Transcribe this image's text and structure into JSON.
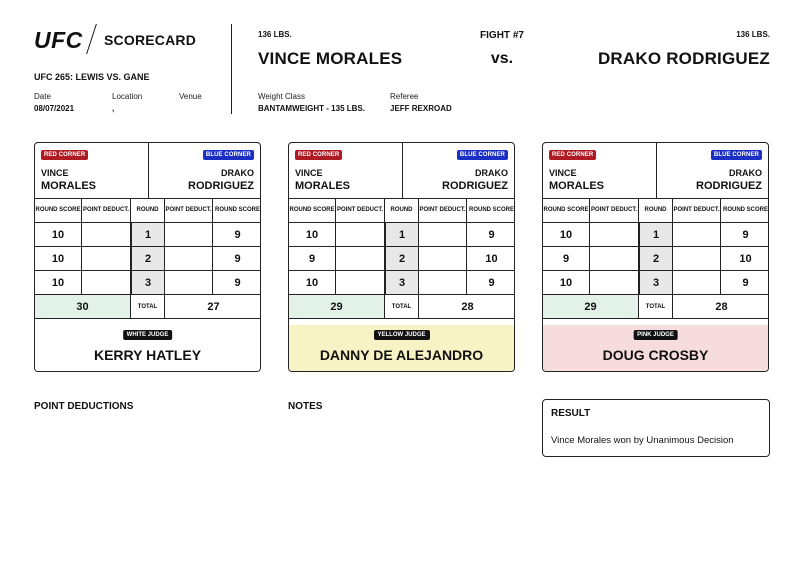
{
  "header": {
    "logo_text": "UFC",
    "title": "SCORECARD",
    "event": "UFC 265: LEWIS VS. GANE",
    "date_label": "Date",
    "date_value": "08/07/2021",
    "location_label": "Location",
    "location_value": ",",
    "venue_label": "Venue",
    "venue_value": "",
    "red_weight": "136 LBS.",
    "red_fighter": "VINCE MORALES",
    "blue_weight": "136 LBS.",
    "blue_fighter": "DRAKO RODRIGUEZ",
    "fight_number": "FIGHT #7",
    "vs": "vs.",
    "weight_class_label": "Weight Class",
    "weight_class_value": "BANTAMWEIGHT - 135 LBS.",
    "referee_label": "Referee",
    "referee_value": "JEFF REXROAD"
  },
  "labels": {
    "red_corner": "RED CORNER",
    "blue_corner": "BLUE CORNER",
    "round_score": "ROUND SCORE",
    "point_deduct": "POINT DEDUCT.",
    "round": "ROUND",
    "total": "TOTAL"
  },
  "cards": [
    {
      "red_first": "VINCE",
      "red_last": "MORALES",
      "blue_first": "DRAKO",
      "blue_last": "RODRIGUEZ",
      "rounds": [
        {
          "red_score": "10",
          "red_deduct": "",
          "round": "1",
          "blue_deduct": "",
          "blue_score": "9"
        },
        {
          "red_score": "10",
          "red_deduct": "",
          "round": "2",
          "blue_deduct": "",
          "blue_score": "9"
        },
        {
          "red_score": "10",
          "red_deduct": "",
          "round": "3",
          "blue_deduct": "",
          "blue_score": "9"
        }
      ],
      "red_total": "30",
      "blue_total": "27",
      "judge_badge": "WHITE JUDGE",
      "judge_name": "KERRY HATLEY",
      "judge_color": "#ffffff"
    },
    {
      "red_first": "VINCE",
      "red_last": "MORALES",
      "blue_first": "DRAKO",
      "blue_last": "RODRIGUEZ",
      "rounds": [
        {
          "red_score": "10",
          "red_deduct": "",
          "round": "1",
          "blue_deduct": "",
          "blue_score": "9"
        },
        {
          "red_score": "9",
          "red_deduct": "",
          "round": "2",
          "blue_deduct": "",
          "blue_score": "10"
        },
        {
          "red_score": "10",
          "red_deduct": "",
          "round": "3",
          "blue_deduct": "",
          "blue_score": "9"
        }
      ],
      "red_total": "29",
      "blue_total": "28",
      "judge_badge": "YELLOW JUDGE",
      "judge_name": "DANNY DE ALEJANDRO",
      "judge_color": "#f8f3c4"
    },
    {
      "red_first": "VINCE",
      "red_last": "MORALES",
      "blue_first": "DRAKO",
      "blue_last": "RODRIGUEZ",
      "rounds": [
        {
          "red_score": "10",
          "red_deduct": "",
          "round": "1",
          "blue_deduct": "",
          "blue_score": "9"
        },
        {
          "red_score": "9",
          "red_deduct": "",
          "round": "2",
          "blue_deduct": "",
          "blue_score": "10"
        },
        {
          "red_score": "10",
          "red_deduct": "",
          "round": "3",
          "blue_deduct": "",
          "blue_score": "9"
        }
      ],
      "red_total": "29",
      "blue_total": "28",
      "judge_badge": "PINK JUDGE",
      "judge_name": "DOUG CROSBY",
      "judge_color": "#f6dcdc"
    }
  ],
  "sections": {
    "point_deductions": "POINT DEDUCTIONS",
    "notes": "NOTES",
    "result_title": "RESULT",
    "result_text": "Vince Morales won by Unanimous Decision"
  },
  "colors": {
    "red_corner": "#b01a22",
    "blue_corner": "#1c2fc4",
    "total_highlight": "#e2f2e8"
  }
}
